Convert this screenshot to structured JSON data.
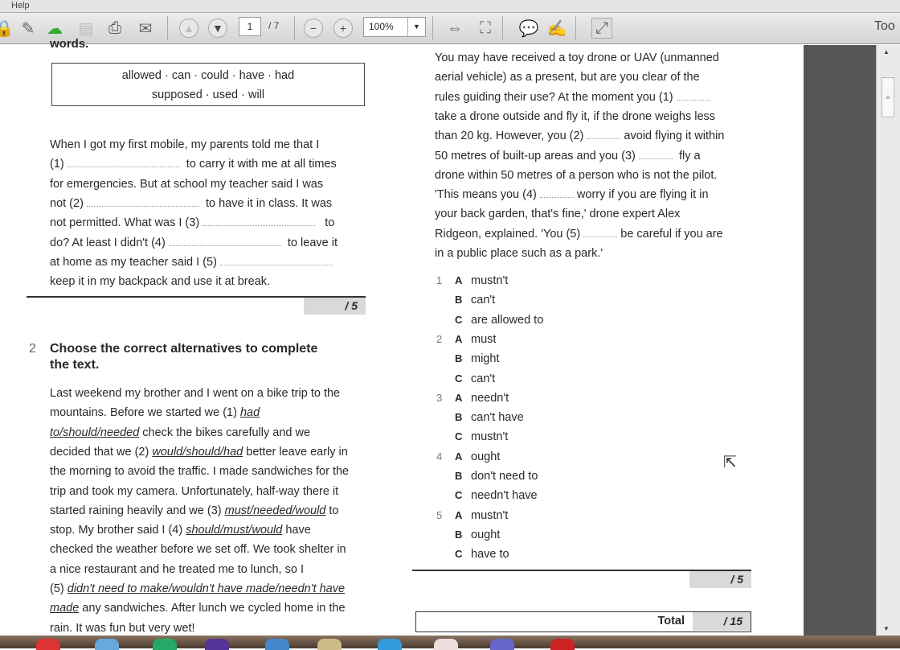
{
  "menu": {
    "help": "Help"
  },
  "toolbar": {
    "page_current": "1",
    "page_total": "/ 7",
    "zoom": "100%",
    "tools": "Too"
  },
  "ex1": {
    "heading_fragment": "words.",
    "word_box": [
      "allowed  ·  can  ·  could  ·  have  ·  had",
      "supposed  ·  used  ·  will"
    ],
    "lines": [
      [
        {
          "t": "When I got my first mobile, my parents told me that I"
        }
      ],
      [
        {
          "t": "(1) "
        },
        {
          "b": 140
        },
        {
          "t": "  to carry it with me at all times"
        }
      ],
      [
        {
          "t": "for emergencies. But at school my teacher said I was"
        }
      ],
      [
        {
          "t": "not (2) "
        },
        {
          "b": 140
        },
        {
          "t": "  to have it in class. It was"
        }
      ],
      [
        {
          "t": "not permitted. What was I (3) "
        },
        {
          "b": 140
        },
        {
          "t": "   to"
        }
      ],
      [
        {
          "t": "do? At least I didn't (4) "
        },
        {
          "b": 140
        },
        {
          "t": "  to leave it"
        }
      ],
      [
        {
          "t": "at home as my teacher said I (5) "
        },
        {
          "b": 140
        }
      ],
      [
        {
          "t": "keep it in my backpack and use it at break."
        }
      ]
    ],
    "score": "/ 5"
  },
  "ex2": {
    "number": "2",
    "heading": [
      "Choose the correct alternatives to complete",
      "the text."
    ],
    "lines": [
      [
        {
          "t": "Last weekend my brother and I went on a bike trip to the"
        }
      ],
      [
        {
          "t": "mountains. Before we started we (1) "
        },
        {
          "u": "had"
        }
      ],
      [
        {
          "u": "to/should/needed"
        },
        {
          "t": " check the bikes carefully and we"
        }
      ],
      [
        {
          "t": "decided that we (2) "
        },
        {
          "u": "would/should/had"
        },
        {
          "t": " better leave early in"
        }
      ],
      [
        {
          "t": "the morning to avoid the traffic. I made sandwiches for the"
        }
      ],
      [
        {
          "t": "trip and took my camera. Unfortunately, half-way there it"
        }
      ],
      [
        {
          "t": "started raining heavily and we (3) "
        },
        {
          "u": "must/needed/would"
        },
        {
          "t": " to"
        }
      ],
      [
        {
          "t": "stop. My brother said I (4) "
        },
        {
          "u": "should/must/would"
        },
        {
          "t": " have"
        }
      ],
      [
        {
          "t": "checked the weather before we set off. We took shelter in"
        }
      ],
      [
        {
          "t": "a nice restaurant and he treated me to lunch, so I"
        }
      ],
      [
        {
          "t": "(5) "
        },
        {
          "u": "didn't need to make/wouldn't have made/needn't have"
        }
      ],
      [
        {
          "u": "made"
        },
        {
          "t": " any sandwiches. After lunch we cycled home in the"
        }
      ],
      [
        {
          "t": "rain. It was fun but very wet!"
        }
      ]
    ]
  },
  "ex3": {
    "lines": [
      [
        {
          "t": "You may have received a toy drone or UAV (unmanned"
        }
      ],
      [
        {
          "t": "aerial vehicle) as a present, but are you clear of the"
        }
      ],
      [
        {
          "t": "rules guiding their use? At the moment you (1) "
        },
        {
          "b": 42
        }
      ],
      [
        {
          "t": "take a drone outside and fly it, if the drone weighs less"
        }
      ],
      [
        {
          "t": "than 20 kg. However, you (2) "
        },
        {
          "b": 42
        },
        {
          "t": " avoid flying it within"
        }
      ],
      [
        {
          "t": "50 metres of built-up areas and you (3) "
        },
        {
          "b": 42
        },
        {
          "t": "  fly a"
        }
      ],
      [
        {
          "t": "drone within 50 metres of a person who is not the pilot."
        }
      ],
      [
        {
          "t": "'This means you (4) "
        },
        {
          "b": 42
        },
        {
          "t": " worry if you are flying it in"
        }
      ],
      [
        {
          "t": "your back garden, that's fine,' drone expert Alex"
        }
      ],
      [
        {
          "t": "Ridgeon, explained. 'You (5) "
        },
        {
          "b": 42
        },
        {
          "t": " be careful if you are"
        }
      ],
      [
        {
          "t": "in a public place such as a park.'"
        }
      ]
    ],
    "options": [
      {
        "n": "1",
        "items": [
          [
            "A",
            "mustn't"
          ],
          [
            "B",
            "can't"
          ],
          [
            "C",
            "are allowed to"
          ]
        ]
      },
      {
        "n": "2",
        "items": [
          [
            "A",
            "must"
          ],
          [
            "B",
            "might"
          ],
          [
            "C",
            "can't"
          ]
        ]
      },
      {
        "n": "3",
        "items": [
          [
            "A",
            "needn't"
          ],
          [
            "B",
            "can't have"
          ],
          [
            "C",
            "mustn't"
          ]
        ]
      },
      {
        "n": "4",
        "items": [
          [
            "A",
            "ought"
          ],
          [
            "B",
            "don't need to"
          ],
          [
            "C",
            "needn't have"
          ]
        ]
      },
      {
        "n": "5",
        "items": [
          [
            "A",
            "mustn't"
          ],
          [
            "B",
            "ought"
          ],
          [
            "C",
            "have to"
          ]
        ]
      }
    ],
    "score": "/ 5",
    "total_label": "Total",
    "total_value": "/ 15"
  }
}
